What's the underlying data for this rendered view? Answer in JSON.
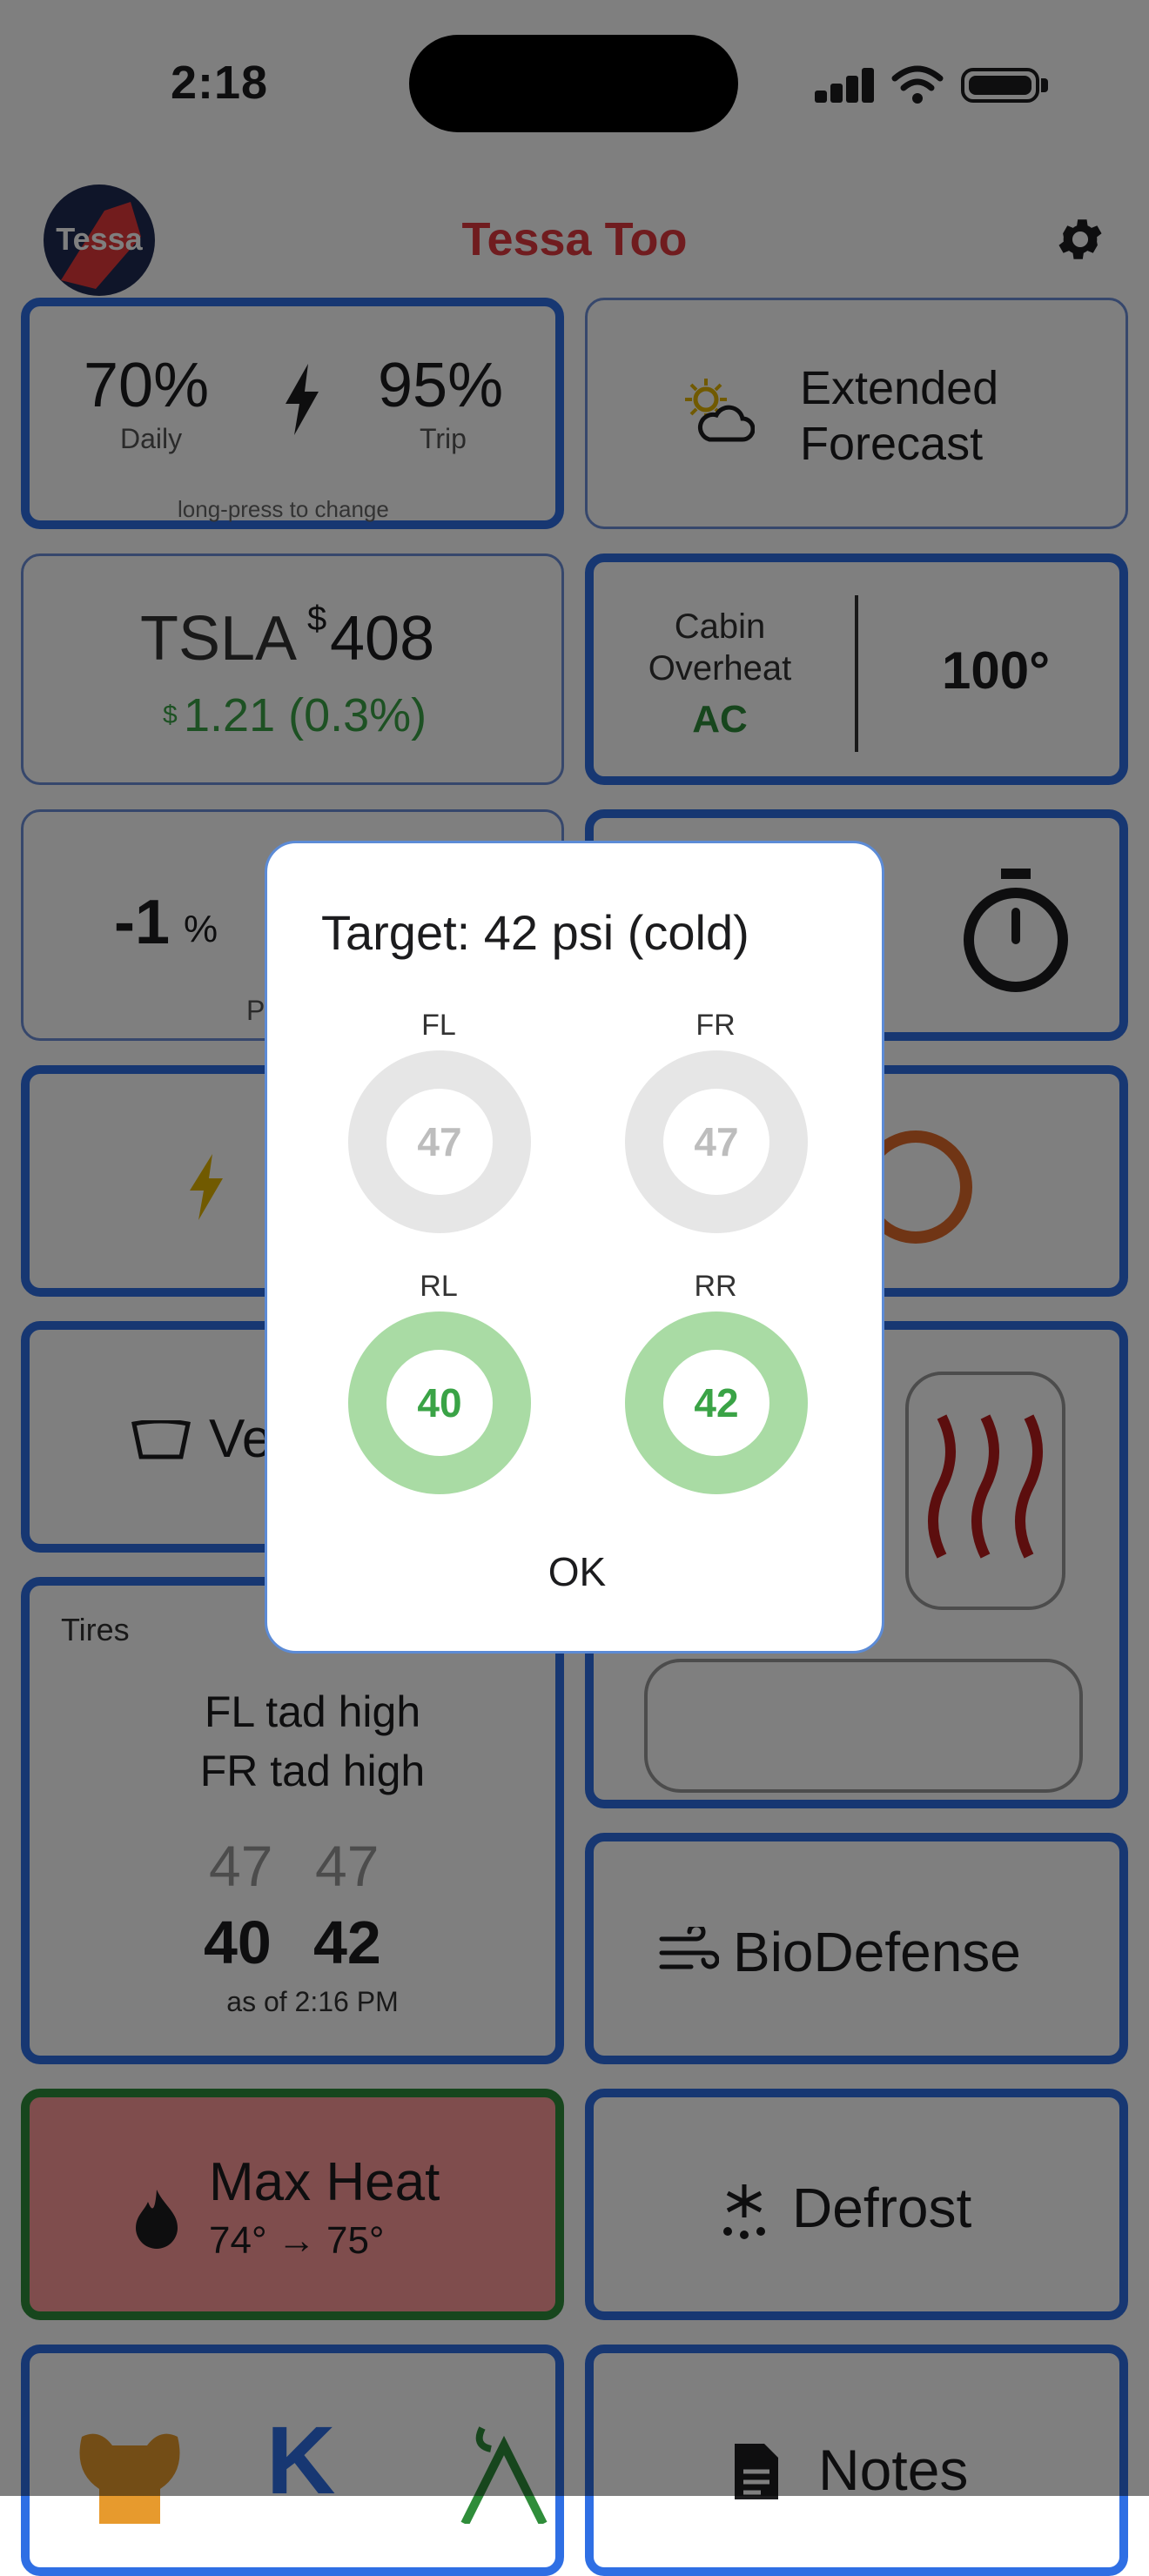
{
  "status_bar": {
    "time": "2:18"
  },
  "header": {
    "avatar_text": "Tessa",
    "title": "Tessa Too"
  },
  "cards": {
    "charge": {
      "daily_value": "70%",
      "daily_label": "Daily",
      "trip_value": "95%",
      "trip_label": "Trip",
      "hint": "long-press to change"
    },
    "forecast": {
      "line1": "Extended",
      "line2": "Forecast"
    },
    "stock": {
      "ticker": "TSLA",
      "currency": "$",
      "price": "408",
      "change_currency": "$",
      "change": "1.21 (0.3%)"
    },
    "cabin": {
      "line1": "Cabin",
      "line2": "Overheat",
      "mode": "AC",
      "temp": "100°"
    },
    "percent": {
      "value": "-1",
      "unit": "%",
      "sub": "P"
    },
    "vent": {
      "label": "Ve"
    },
    "tires": {
      "title": "Tires",
      "status1": "FL tad high",
      "status2": "FR tad high",
      "front_left": "47",
      "front_right": "47",
      "rear_left": "40",
      "rear_right": "42",
      "as_of": "as of 2:16 PM"
    },
    "biodefense": {
      "label": "BioDefense"
    },
    "max_heat": {
      "label": "Max Heat",
      "temps": "74° → 75°"
    },
    "defrost": {
      "label": "Defrost"
    },
    "notes": {
      "label": "Notes"
    },
    "bottom_letter": {
      "label": "K"
    }
  },
  "dialog": {
    "title": "Target: 42 psi (cold)",
    "tires": [
      {
        "label": "FL",
        "value": "47"
      },
      {
        "label": "FR",
        "value": "47"
      },
      {
        "label": "RL",
        "value": "40"
      },
      {
        "label": "RR",
        "value": "42"
      }
    ],
    "ok_label": "OK"
  },
  "colors": {
    "accent_blue": "#2f6fe4",
    "title_red": "#e0393e",
    "ok_green": "#3aa346",
    "ring_gray": "#e6e6e6",
    "ring_green": "#a9dba4"
  }
}
